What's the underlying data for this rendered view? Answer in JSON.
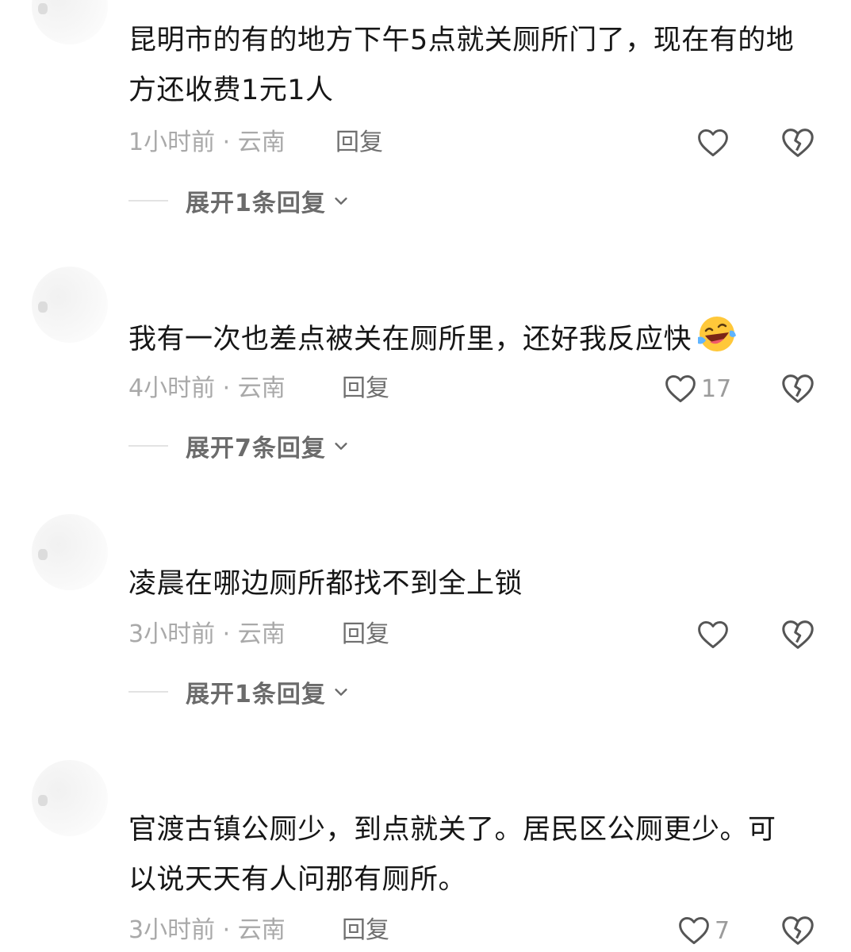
{
  "comments": [
    {
      "username": "",
      "text": "昆明市的有的地方下午5点就关厕所门了，现在有的地方还收费1元1人",
      "time": "1小时前 · 云南",
      "reply_label": "回复",
      "likes": "",
      "expand_label": "展开1条回复"
    },
    {
      "username": "",
      "text": "我有一次也差点被关在厕所里，还好我反应快",
      "emoji": "laughing-crying-emoji",
      "time": "4小时前 · 云南",
      "reply_label": "回复",
      "likes": "17",
      "expand_label": "展开7条回复"
    },
    {
      "username": "",
      "text": "凌晨在哪边厕所都找不到全上锁",
      "time": "3小时前 · 云南",
      "reply_label": "回复",
      "likes": "",
      "expand_label": "展开1条回复"
    },
    {
      "username": "",
      "text": "官渡古镇公厕少，到点就关了。居民区公厕更少。可以说天天有人问那有厕所。",
      "time": "3小时前 · 云南",
      "reply_label": "回复",
      "likes": "7"
    }
  ],
  "icons": {
    "like": "heart-outline-icon",
    "dislike": "broken-heart-icon",
    "expand": "chevron-down-icon"
  },
  "colors": {
    "text": "#161616",
    "meta": "#a9a9a9",
    "icon": "#555555"
  }
}
